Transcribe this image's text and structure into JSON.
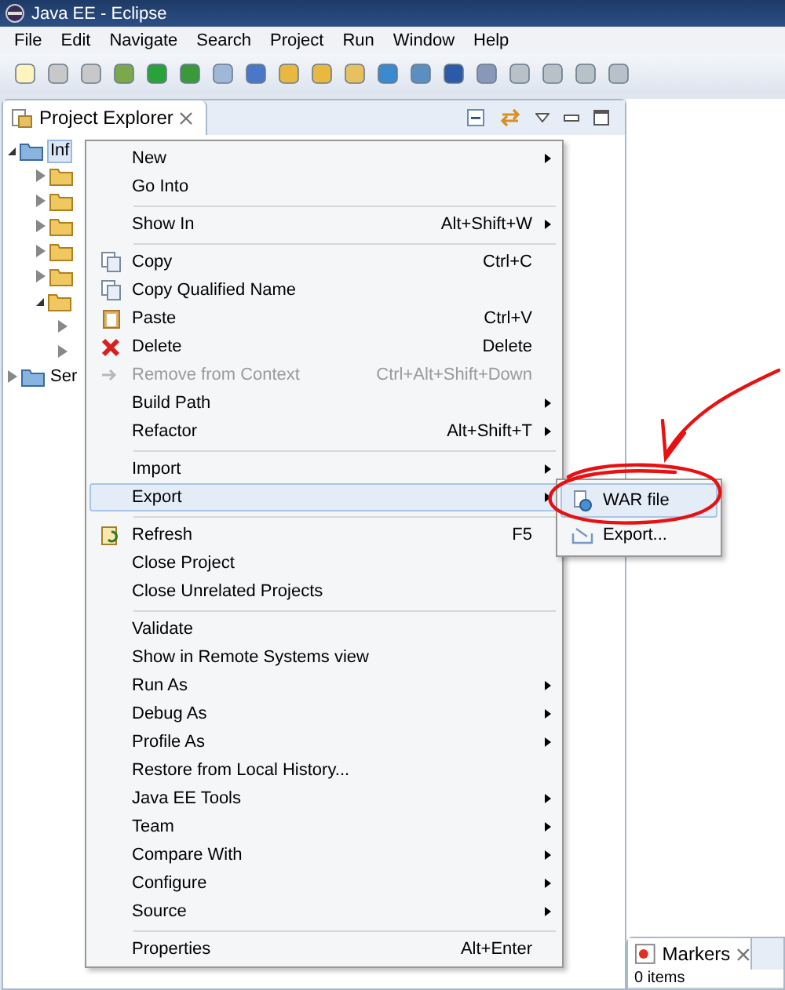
{
  "window": {
    "title": "Java EE - Eclipse"
  },
  "menu_bar": [
    "File",
    "Edit",
    "Navigate",
    "Search",
    "Project",
    "Run",
    "Window",
    "Help"
  ],
  "project_explorer": {
    "title": "Project Explorer",
    "tree": [
      {
        "label": "Inf",
        "expanded": true,
        "children": [
          {
            "expanded": false
          },
          {
            "expanded": false
          },
          {
            "expanded": false
          },
          {
            "expanded": false
          },
          {
            "expanded": false
          },
          {
            "expanded": true,
            "children": [
              {
                "expanded": false
              },
              {
                "expanded": false
              }
            ]
          }
        ]
      },
      {
        "label": "Ser",
        "expanded": false
      }
    ]
  },
  "context_menu": {
    "groups": [
      [
        {
          "label": "New",
          "submenu": true,
          "disabled": false,
          "selected": false
        },
        {
          "label": "Go Into",
          "submenu": false,
          "disabled": false,
          "selected": false
        }
      ],
      [
        {
          "label": "Show In",
          "shortcut": "Alt+Shift+W",
          "submenu": true,
          "disabled": false,
          "selected": false
        }
      ],
      [
        {
          "label": "Copy",
          "shortcut": "Ctrl+C",
          "submenu": false,
          "disabled": false,
          "selected": false
        },
        {
          "label": "Copy Qualified Name",
          "submenu": false,
          "disabled": false,
          "selected": false
        },
        {
          "label": "Paste",
          "shortcut": "Ctrl+V",
          "submenu": false,
          "disabled": false,
          "selected": false
        },
        {
          "label": "Delete",
          "shortcut": "Delete",
          "submenu": false,
          "disabled": false,
          "selected": false
        },
        {
          "label": "Remove from Context",
          "shortcut": "Ctrl+Alt+Shift+Down",
          "submenu": false,
          "disabled": true,
          "selected": false
        },
        {
          "label": "Build Path",
          "submenu": true,
          "disabled": false,
          "selected": false
        },
        {
          "label": "Refactor",
          "shortcut": "Alt+Shift+T",
          "submenu": true,
          "disabled": false,
          "selected": false
        }
      ],
      [
        {
          "label": "Import",
          "submenu": true,
          "disabled": false,
          "selected": false
        },
        {
          "label": "Export",
          "submenu": true,
          "disabled": false,
          "selected": true
        }
      ],
      [
        {
          "label": "Refresh",
          "shortcut": "F5",
          "submenu": false,
          "disabled": false,
          "selected": false
        },
        {
          "label": "Close Project",
          "submenu": false,
          "disabled": false,
          "selected": false
        },
        {
          "label": "Close Unrelated Projects",
          "submenu": false,
          "disabled": false,
          "selected": false
        }
      ],
      [
        {
          "label": "Validate",
          "submenu": false,
          "disabled": false,
          "selected": false
        },
        {
          "label": "Show in Remote Systems view",
          "submenu": false,
          "disabled": false,
          "selected": false
        },
        {
          "label": "Run As",
          "submenu": true,
          "disabled": false,
          "selected": false
        },
        {
          "label": "Debug As",
          "submenu": true,
          "disabled": false,
          "selected": false
        },
        {
          "label": "Profile As",
          "submenu": true,
          "disabled": false,
          "selected": false
        },
        {
          "label": "Restore from Local History...",
          "submenu": false,
          "disabled": false,
          "selected": false
        },
        {
          "label": "Java EE Tools",
          "submenu": true,
          "disabled": false,
          "selected": false
        },
        {
          "label": "Team",
          "submenu": true,
          "disabled": false,
          "selected": false
        },
        {
          "label": "Compare With",
          "submenu": true,
          "disabled": false,
          "selected": false
        },
        {
          "label": "Configure",
          "submenu": true,
          "disabled": false,
          "selected": false
        },
        {
          "label": "Source",
          "submenu": true,
          "disabled": false,
          "selected": false
        }
      ],
      [
        {
          "label": "Properties",
          "shortcut": "Alt+Enter",
          "submenu": false,
          "disabled": false,
          "selected": false
        }
      ]
    ]
  },
  "export_submenu": [
    {
      "label": "WAR file",
      "selected": true
    },
    {
      "label": "Export...",
      "selected": false
    }
  ],
  "markers": {
    "title": "Markers",
    "status": "0 items"
  }
}
